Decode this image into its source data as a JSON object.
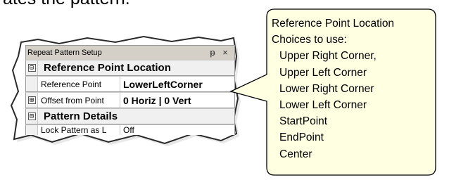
{
  "header_text": "ates the pattern.",
  "panel": {
    "title": "Repeat Pattern Setup",
    "pin_icon": "pin-icon",
    "close_icon": "close-icon",
    "pin_glyph": "ᵽ",
    "close_glyph": "×",
    "rows": [
      {
        "kind": "category",
        "expander": "⊟",
        "label": "Reference Point Location"
      },
      {
        "kind": "property",
        "expander": "",
        "label": "Reference Point",
        "value": "LowerLeftCorner"
      },
      {
        "kind": "property",
        "expander": "⊞",
        "label": "Offset from Point",
        "value": "0 Horiz | 0 Vert"
      },
      {
        "kind": "category",
        "expander": "⊟",
        "label": "Pattern Details"
      },
      {
        "kind": "property",
        "expander": "",
        "label": "Lock Pattern as L",
        "value": "Off"
      }
    ]
  },
  "callout": {
    "lines": [
      "Reference Point Location",
      "Choices to use:",
      "Upper Right Corner,",
      "Upper Left Corner",
      "Lower Right Corner",
      "Lower Left Corner",
      "StartPoint",
      "EndPoint",
      "Center"
    ],
    "fill": "#ffffe1",
    "border": "#000000"
  }
}
